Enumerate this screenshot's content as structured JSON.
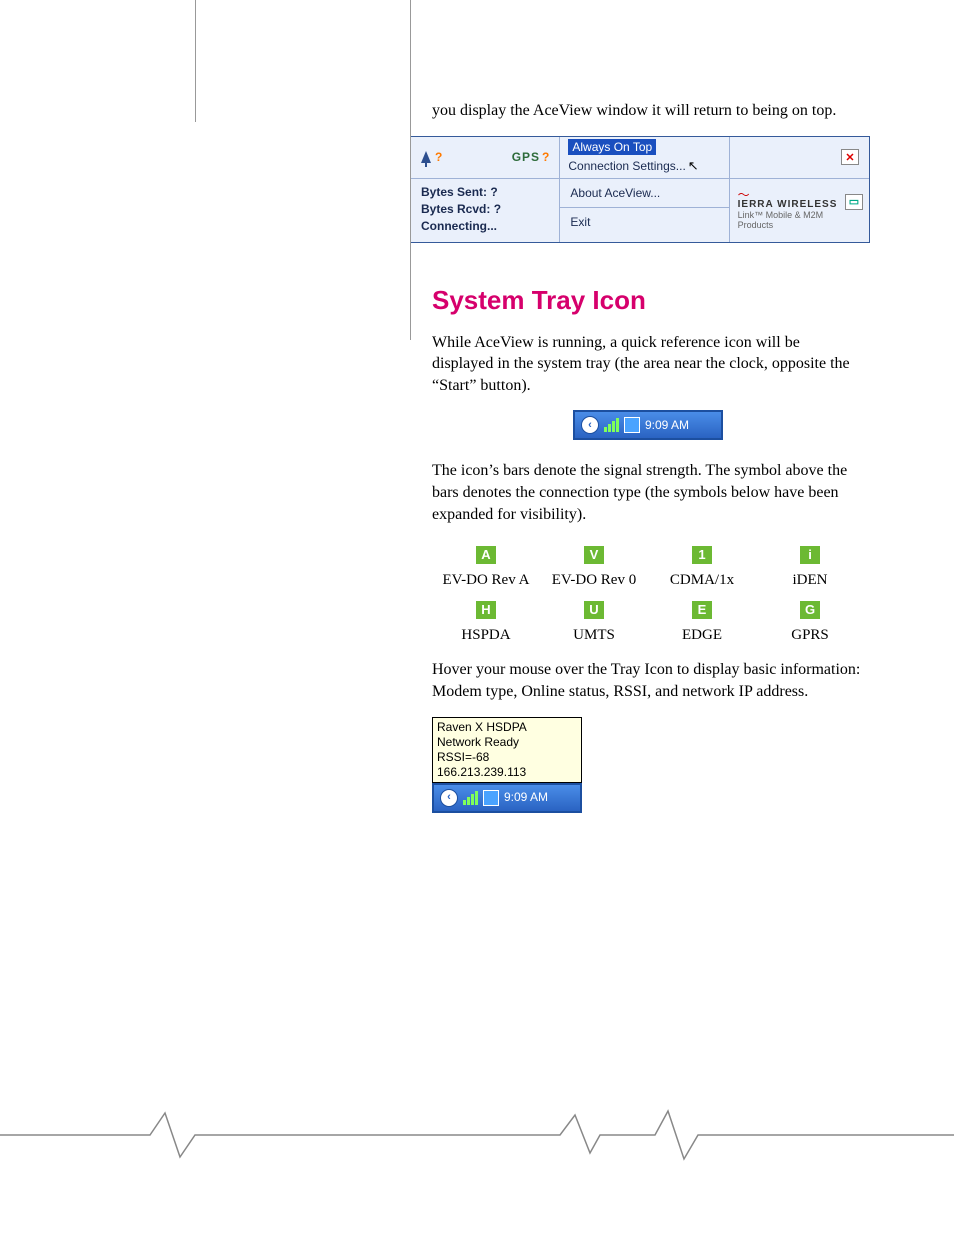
{
  "lead_para": "you display the AceView window it will return to being on top.",
  "app": {
    "gps": "GPS",
    "menu": {
      "always_on_top": "Always On Top",
      "connection_settings": "Connection Settings...",
      "about": "About AceView...",
      "exit": "Exit"
    },
    "status": {
      "bytes_sent": "Bytes Sent: ?",
      "bytes_rcvd": "Bytes Rcvd: ?",
      "connecting": "Connecting..."
    },
    "brand_top": "IERRA WIRELESS",
    "brand_sub": "Link™ Mobile & M2M Products"
  },
  "section_title": "System Tray Icon",
  "para1": "While AceView is running, a quick reference icon will be displayed in the system tray (the area near the clock, opposite the “Start” button).",
  "tray_time": "9:09 AM",
  "para2": "The icon’s bars denote the signal strength.  The symbol above the bars denotes the connection type (the symbols below have been expanded for visibility).",
  "icons": {
    "row1": [
      {
        "glyph": "A",
        "label": "EV-DO Rev A"
      },
      {
        "glyph": "V",
        "label": "EV-DO Rev 0"
      },
      {
        "glyph": "1",
        "label": "CDMA/1x"
      },
      {
        "glyph": "i",
        "label": "iDEN"
      }
    ],
    "row2": [
      {
        "glyph": "H",
        "label": "HSPDA"
      },
      {
        "glyph": "U",
        "label": "UMTS"
      },
      {
        "glyph": "E",
        "label": "EDGE"
      },
      {
        "glyph": "G",
        "label": "GPRS"
      }
    ]
  },
  "para3": "Hover your mouse over the Tray Icon to display basic information: Modem type, Online status, RSSI, and network IP address.",
  "tooltip": {
    "l1": "Raven X HSDPA",
    "l2": "Network Ready",
    "l3": "RSSI=-68",
    "l4": "166.213.239.113"
  }
}
